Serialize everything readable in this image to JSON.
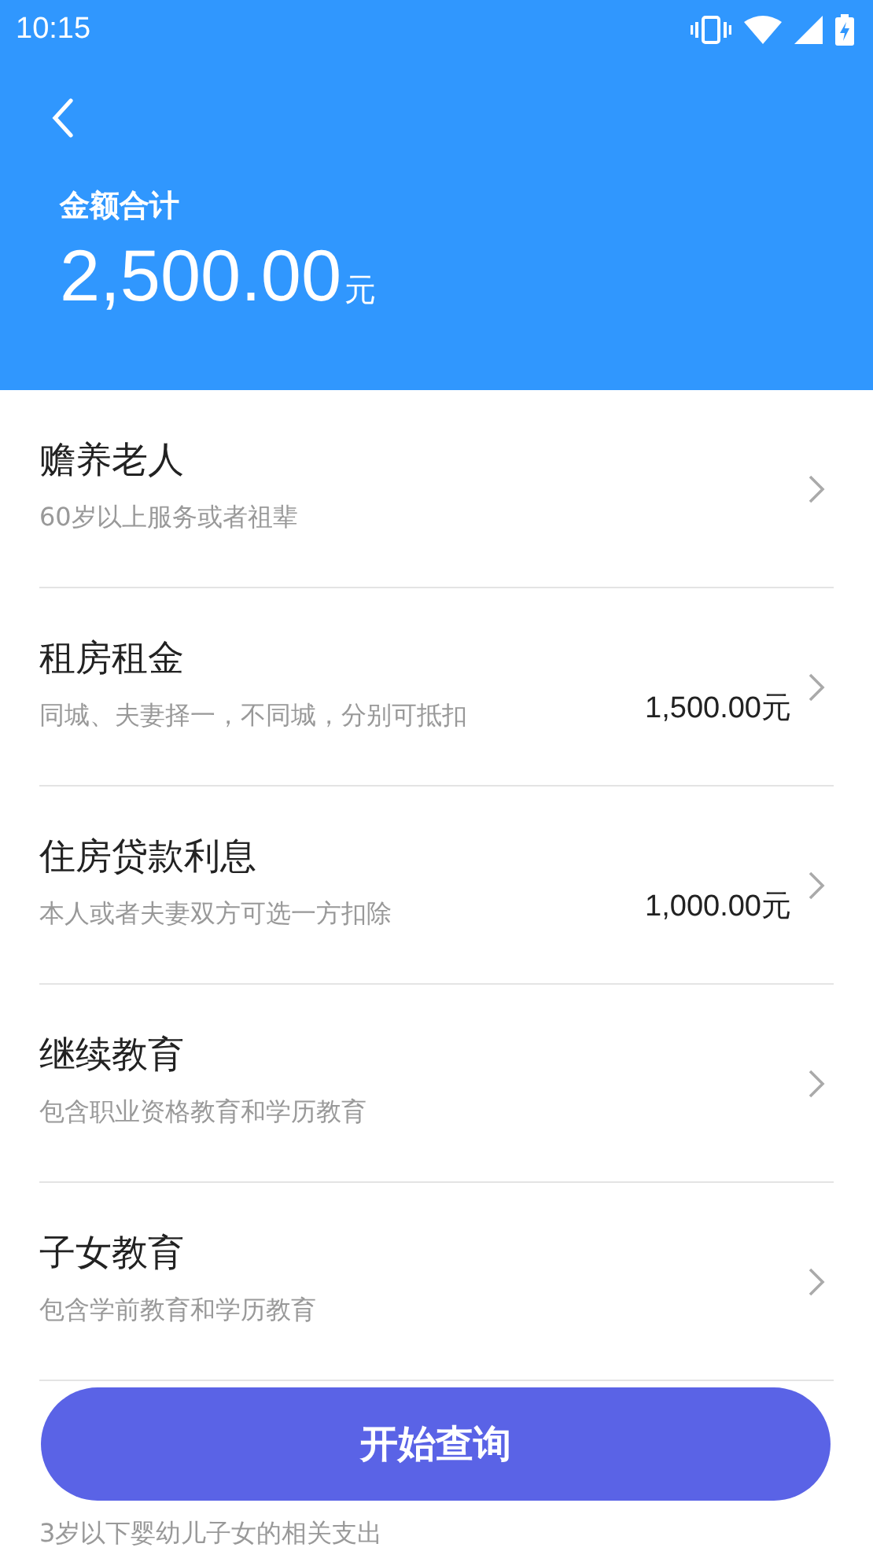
{
  "status_bar": {
    "time": "10:15"
  },
  "header": {
    "label": "金额合计",
    "amount": "2,500.00",
    "unit": "元"
  },
  "items": [
    {
      "title": "赡养老人",
      "subtitle": "60岁以上服务或者祖辈",
      "chevron": true
    },
    {
      "title": "租房租金",
      "subtitle": "同城、夫妻择一，不同城，分别可抵扣",
      "amount": "1,500.00元",
      "chevron": true
    },
    {
      "title": "住房贷款利息",
      "subtitle": "本人或者夫妻双方可选一方扣除",
      "amount": "1,000.00元",
      "chevron": true
    },
    {
      "title": "继续教育",
      "subtitle": "包含职业资格教育和学历教育",
      "chevron": true
    },
    {
      "title": "子女教育",
      "subtitle": "包含学前教育和学历教育",
      "chevron": true
    },
    {
      "subtitle": "3岁以下婴幼儿子女的相关支出",
      "chevron": false
    }
  ],
  "button": {
    "label": "开始查询"
  }
}
